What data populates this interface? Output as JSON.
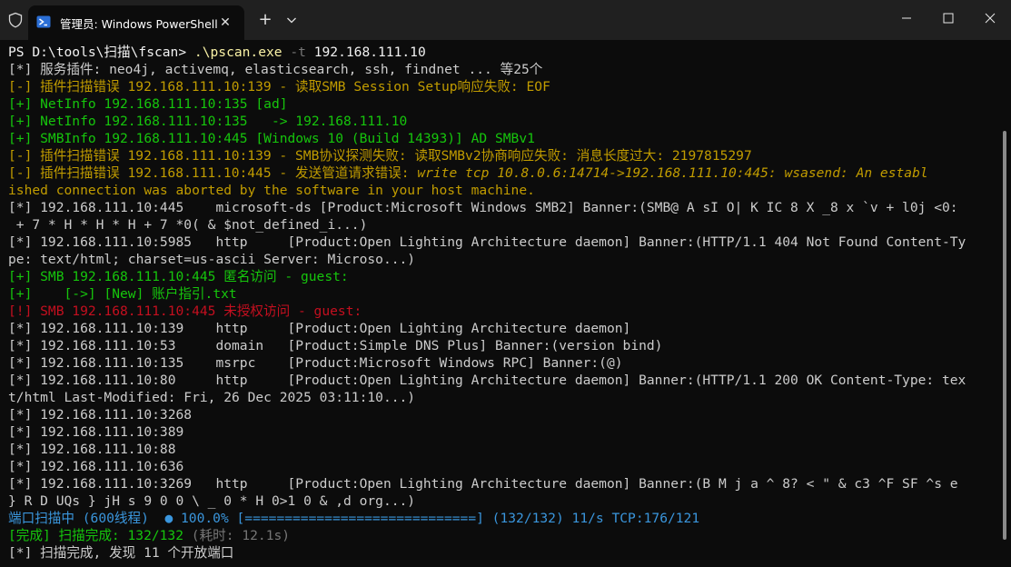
{
  "window": {
    "tab_title": "管理员: Windows PowerShell",
    "tab_close_glyph": "✕",
    "new_tab_glyph": "+",
    "colors": {
      "titlebar": "#202020",
      "terminal_bg": "#0c0c0c",
      "white": "#cccccc",
      "yellow": "#f9f1a5",
      "green": "#16c60c",
      "red": "#e74856",
      "cyan": "#3a96dd"
    },
    "icons": [
      "shield-icon",
      "powershell-icon",
      "close-icon",
      "plus-icon",
      "chevron-down-icon",
      "minimize-icon",
      "maximize-icon",
      "close-window-icon"
    ]
  },
  "terminal": {
    "lines": [
      {
        "segments": [
          {
            "t": "PS D:\\tools\\扫描\\fscan> ",
            "c": "bw"
          },
          {
            "t": ".\\pscan.exe",
            "c": "y"
          },
          {
            "t": " -t ",
            "c": "gr"
          },
          {
            "t": "192.168.111.10",
            "c": "bw"
          }
        ]
      },
      {
        "segments": [
          {
            "t": "[*] 服务插件: neo4j, activemq, elasticsearch, ssh, findnet ... 等25个",
            "c": "w"
          }
        ]
      },
      {
        "segments": [
          {
            "t": "[-] 插件扫描错误 192.168.111.10:139 - 读取SMB Session Setup响应失败: EOF",
            "c": "dy"
          }
        ]
      },
      {
        "segments": [
          {
            "t": "[+] NetInfo 192.168.111.10:135 [ad]",
            "c": "g"
          }
        ]
      },
      {
        "segments": [
          {
            "t": "[+] NetInfo 192.168.111.10:135   -> 192.168.111.10",
            "c": "g"
          }
        ]
      },
      {
        "segments": [
          {
            "t": "[+] SMBInfo 192.168.111.10:445 [Windows 10 (Build 14393)] AD SMBv1",
            "c": "g"
          }
        ]
      },
      {
        "segments": [
          {
            "t": "[-] 插件扫描错误 192.168.111.10:139 - SMB协议探测失败: 读取SMBv2协商响应失败: 消息长度过大: 2197815297",
            "c": "dy"
          }
        ]
      },
      {
        "segments": [
          {
            "t": "[-] 插件扫描错误 192.168.111.10:445 - 发送管道请求错误: ",
            "c": "dy"
          },
          {
            "t": "write tcp 10.8.0.6:14714->192.168.111.10:445: wsasend: An establ",
            "c": "dy",
            "i": true
          }
        ]
      },
      {
        "segments": [
          {
            "t": "ished connection was aborted by the software in your host machine.",
            "c": "dy"
          }
        ]
      },
      {
        "segments": [
          {
            "t": "[*] 192.168.111.10:445    microsoft-ds [Product:Microsoft Windows SMB2] Banner:(SMB@ A sI O| K IC 8 X _8 x `v + l0j <0:",
            "c": "w"
          }
        ]
      },
      {
        "segments": [
          {
            "t": " + 7 * H * H * H + 7 *0( & $not_defined_i...)",
            "c": "w"
          }
        ]
      },
      {
        "segments": [
          {
            "t": "[*] 192.168.111.10:5985   http     [Product:Open Lighting Architecture daemon] Banner:(HTTP/1.1 404 Not Found Content-Ty",
            "c": "w"
          }
        ]
      },
      {
        "segments": [
          {
            "t": "pe: text/html; charset=us-ascii Server: Microso...)",
            "c": "w"
          }
        ]
      },
      {
        "segments": [
          {
            "t": "[+] SMB 192.168.111.10:445 匿名访问 - guest:",
            "c": "g"
          }
        ]
      },
      {
        "segments": [
          {
            "t": "[+]    [->] [New] 账户指引.txt",
            "c": "g"
          }
        ]
      },
      {
        "segments": [
          {
            "t": "[!] SMB 192.168.111.10:445 未授权访问 - guest:",
            "c": "dr"
          }
        ]
      },
      {
        "segments": [
          {
            "t": "[*] 192.168.111.10:139    http     [Product:Open Lighting Architecture daemon]",
            "c": "w"
          }
        ]
      },
      {
        "segments": [
          {
            "t": "[*] 192.168.111.10:53     domain   [Product:Simple DNS Plus] Banner:(version bind)",
            "c": "w"
          }
        ]
      },
      {
        "segments": [
          {
            "t": "[*] 192.168.111.10:135    msrpc    [Product:Microsoft Windows RPC] Banner:(@)",
            "c": "w"
          }
        ]
      },
      {
        "segments": [
          {
            "t": "[*] 192.168.111.10:80     http     [Product:Open Lighting Architecture daemon] Banner:(HTTP/1.1 200 OK Content-Type: tex",
            "c": "w"
          }
        ]
      },
      {
        "segments": [
          {
            "t": "t/html Last-Modified: Fri, 26 Dec 2025 03:11:10...)",
            "c": "w"
          }
        ]
      },
      {
        "segments": [
          {
            "t": "[*] 192.168.111.10:3268",
            "c": "w"
          }
        ]
      },
      {
        "segments": [
          {
            "t": "[*] 192.168.111.10:389",
            "c": "w"
          }
        ]
      },
      {
        "segments": [
          {
            "t": "[*] 192.168.111.10:88",
            "c": "w"
          }
        ]
      },
      {
        "segments": [
          {
            "t": "[*] 192.168.111.10:636",
            "c": "w"
          }
        ]
      },
      {
        "segments": [
          {
            "t": "[*] 192.168.111.10:3269   http     [Product:Open Lighting Architecture daemon] Banner:(B M j a ^ 8? < \" & c3 ^F SF ^s e",
            "c": "w"
          }
        ]
      },
      {
        "segments": [
          {
            "t": "} R D UQs } jH s 9 0 0 \\ _ 0 * H 0>1 0 & ,d org...)",
            "c": "w"
          }
        ]
      },
      {
        "segments": [
          {
            "t": "端口扫描中 (600线程)  ● 100.0% [=============================] (132/132) 11/s TCP:176/121",
            "c": "c"
          }
        ]
      },
      {
        "segments": [
          {
            "t": "[完成] 扫描完成: 132/132 ",
            "c": "g"
          },
          {
            "t": "(耗时: 12.1s)",
            "c": "gr"
          }
        ]
      },
      {
        "segments": [
          {
            "t": "[*] 扫描完成, 发现 11 个开放端口",
            "c": "w"
          }
        ]
      }
    ]
  }
}
